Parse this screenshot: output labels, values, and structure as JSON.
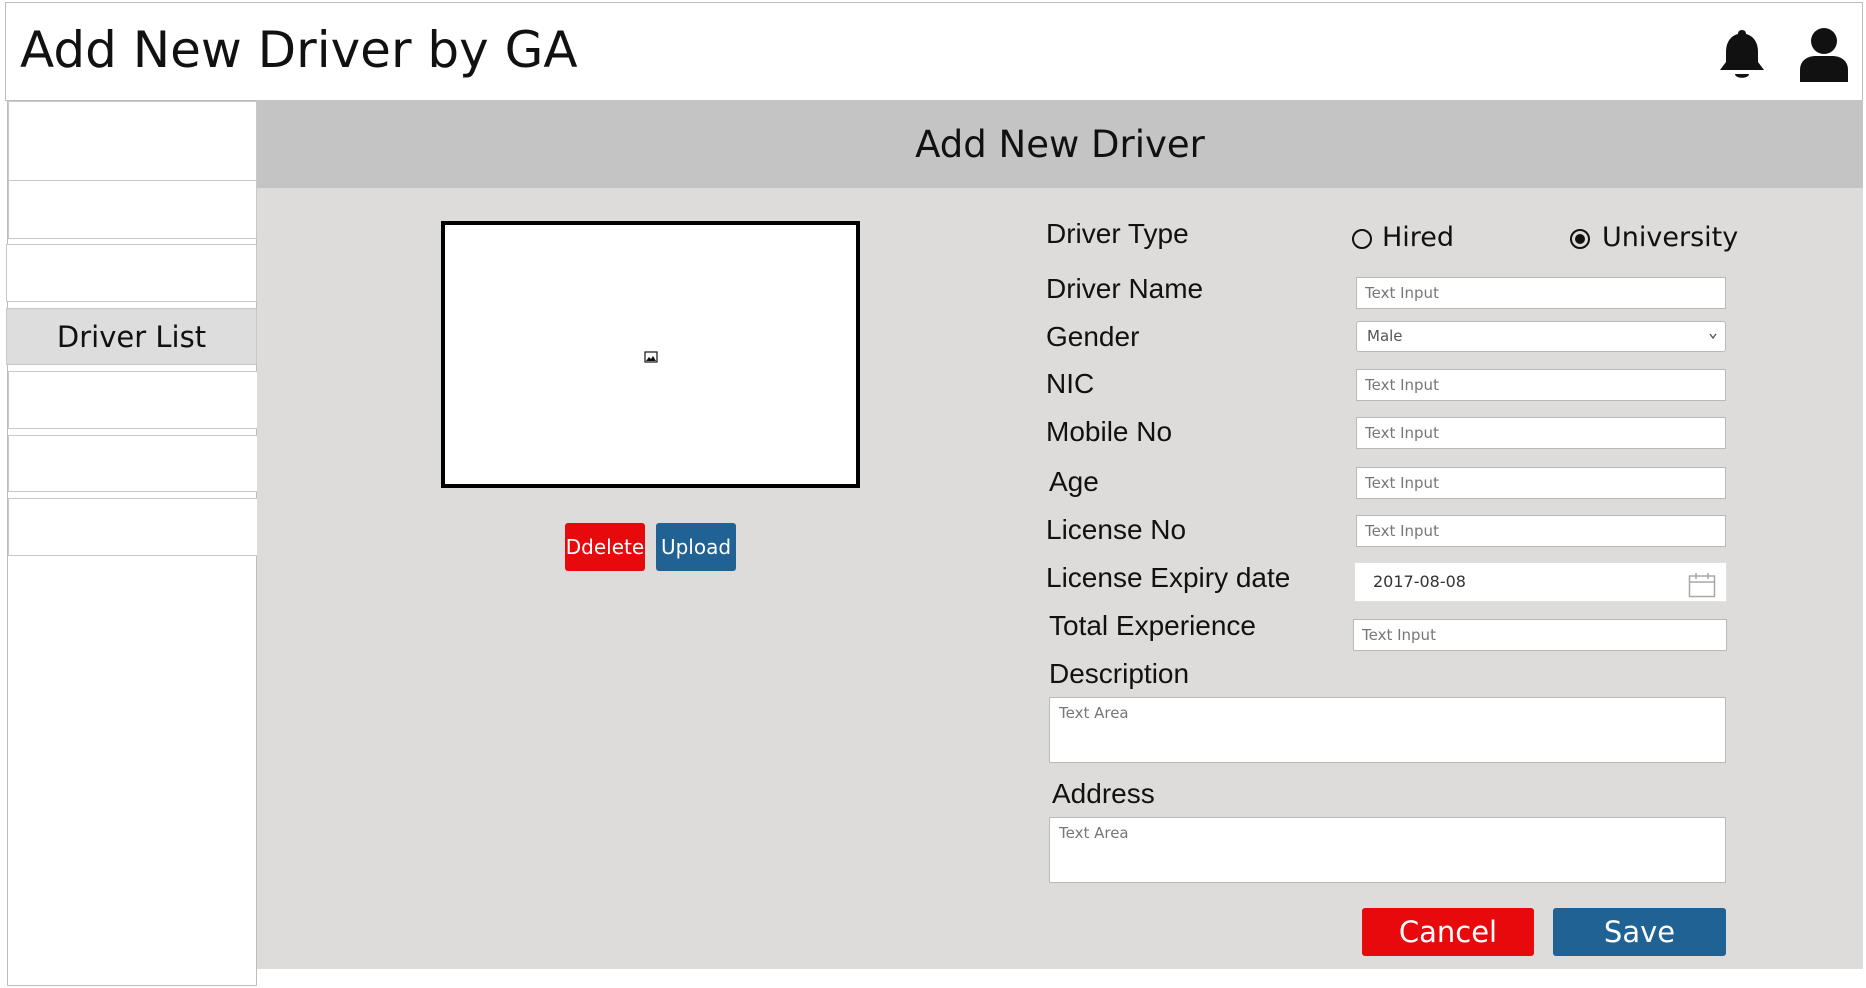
{
  "header": {
    "title": "Add New Driver by GA",
    "icons": [
      "bell-icon",
      "user-icon"
    ]
  },
  "sidebar": {
    "items": [
      {
        "label": ""
      },
      {
        "label": ""
      },
      {
        "label": ""
      },
      {
        "label": "Driver List",
        "active": true
      },
      {
        "label": ""
      },
      {
        "label": ""
      },
      {
        "label": ""
      }
    ]
  },
  "main": {
    "title": "Add New Driver"
  },
  "photo": {
    "icon": "image-placeholder-icon",
    "delete_label": "Ddelete",
    "upload_label": "Upload"
  },
  "form": {
    "driver_type": {
      "label": "Driver Type",
      "options": [
        "Hired",
        "University"
      ],
      "selected": "University"
    },
    "driver_name": {
      "label": "Driver Name",
      "placeholder": "Text Input"
    },
    "gender": {
      "label": "Gender",
      "value": "Male"
    },
    "nic": {
      "label": "NIC",
      "placeholder": "Text Input"
    },
    "mobile_no": {
      "label": "Mobile No",
      "placeholder": "Text Input"
    },
    "age": {
      "label": "Age",
      "placeholder": "Text Input"
    },
    "license_no": {
      "label": "License No",
      "placeholder": "Text Input"
    },
    "license_expiry": {
      "label": "License Expiry date",
      "value": "2017-08-08"
    },
    "total_experience": {
      "label": "Total Experience",
      "placeholder": "Text Input"
    },
    "description": {
      "label": "Description",
      "placeholder": "Text Area"
    },
    "address": {
      "label": "Address",
      "placeholder": "Text Area"
    }
  },
  "actions": {
    "cancel_label": "Cancel",
    "save_label": "Save"
  },
  "colors": {
    "danger": "#e8090c",
    "primary": "#1f6293",
    "panel_bg": "#dedbdb",
    "panel_header_bg": "#c4c4c4"
  }
}
